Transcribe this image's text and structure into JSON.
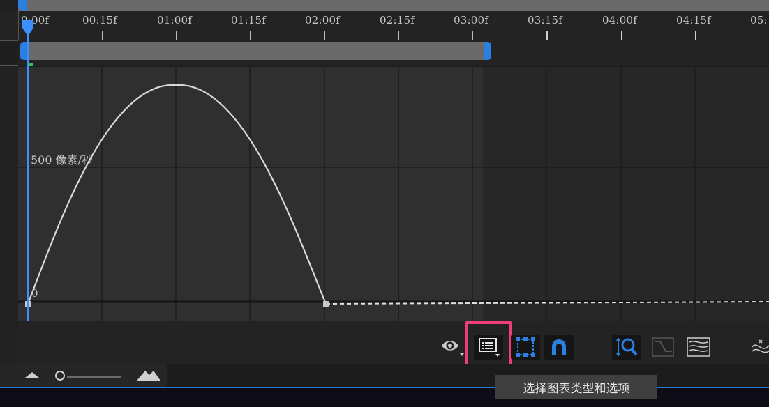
{
  "timeline": {
    "ticks": [
      "0:00f",
      "00:15f",
      "01:00f",
      "01:15f",
      "02:00f",
      "02:15f",
      "03:00f",
      "03:15f",
      "04:00f",
      "04:15f",
      "05:"
    ]
  },
  "graph": {
    "value_label_top": "500 像素/秒",
    "value_label_zero": "0"
  },
  "toolbar": {
    "show_properties_icon": "eye-icon",
    "chart_type_icon": "list-menu-icon",
    "transform_box_icon": "transform-box-icon",
    "snap_icon": "magnet-icon",
    "auto_zoom_icon": "auto-zoom-icon",
    "fit_selection_icon": "fit-selection-icon",
    "fit_all_icon": "fit-all-icon",
    "separate_dimensions_icon": "separate-dimensions-icon",
    "tooltip": "选择图表类型和选项"
  },
  "zoom": {
    "zoom_out_icon": "mountain-small-icon",
    "zoom_in_icon": "mountain-large-icon",
    "level": 0.05
  },
  "colors": {
    "accent": "#2b7fe0",
    "highlight": "#ef3d7b",
    "graph_bg": "#2f2f2f",
    "curve": "#d8d8d8"
  }
}
